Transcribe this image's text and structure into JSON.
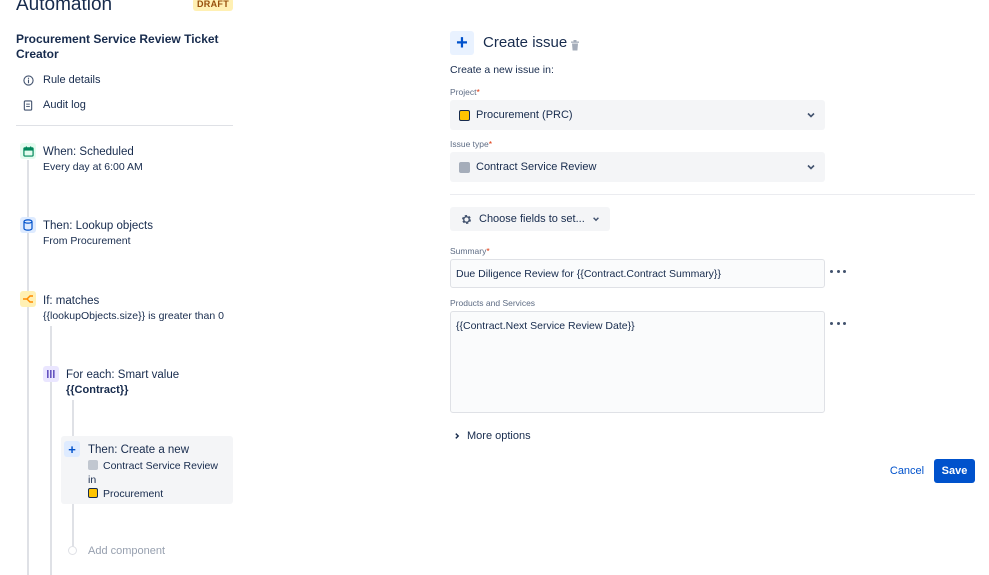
{
  "app": {
    "title": "Automation",
    "badge": "DRAFT"
  },
  "rule": {
    "name": "Procurement Service Review Ticket Creator"
  },
  "nav": [
    {
      "label": "Rule details",
      "icon": "info-icon"
    },
    {
      "label": "Audit log",
      "icon": "document-icon"
    }
  ],
  "components": {
    "trigger": {
      "title": "When: Scheduled",
      "subtitle": "Every day at 6:00 AM"
    },
    "lookup": {
      "title": "Then: Lookup objects",
      "subtitle": "From Procurement"
    },
    "condition": {
      "title": "If: matches",
      "subtitle": "{{lookupObjects.size}} is greater than 0"
    },
    "foreach": {
      "title": "For each: Smart value",
      "subtitle": "{{Contract}}"
    },
    "action": {
      "title": "Then: Create a new",
      "issue_type": "Contract Service Review",
      "in_label": "in",
      "project": "Procurement"
    },
    "add_component": "Add component"
  },
  "editor": {
    "title": "Create issue",
    "subtitle": "Create a new issue in:",
    "project_label": "Project",
    "project_value": "Procurement (PRC)",
    "issue_type_label": "Issue type",
    "issue_type_value": "Contract Service Review",
    "choose_fields": "Choose fields to set...",
    "summary_label": "Summary",
    "summary_value": "Due Diligence Review for {{Contract.Contract Summary}}",
    "products_label": "Products and Services",
    "products_value": "{{Contract.Next Service Review Date}}",
    "more_options": "More options",
    "required_marker": "*"
  },
  "footer": {
    "cancel": "Cancel",
    "save": "Save"
  },
  "colors": {
    "accent": "#0052cc",
    "draft_bg": "#fff0b3",
    "trigger_green": "#00875a",
    "project_yellow": "#ffc400"
  }
}
